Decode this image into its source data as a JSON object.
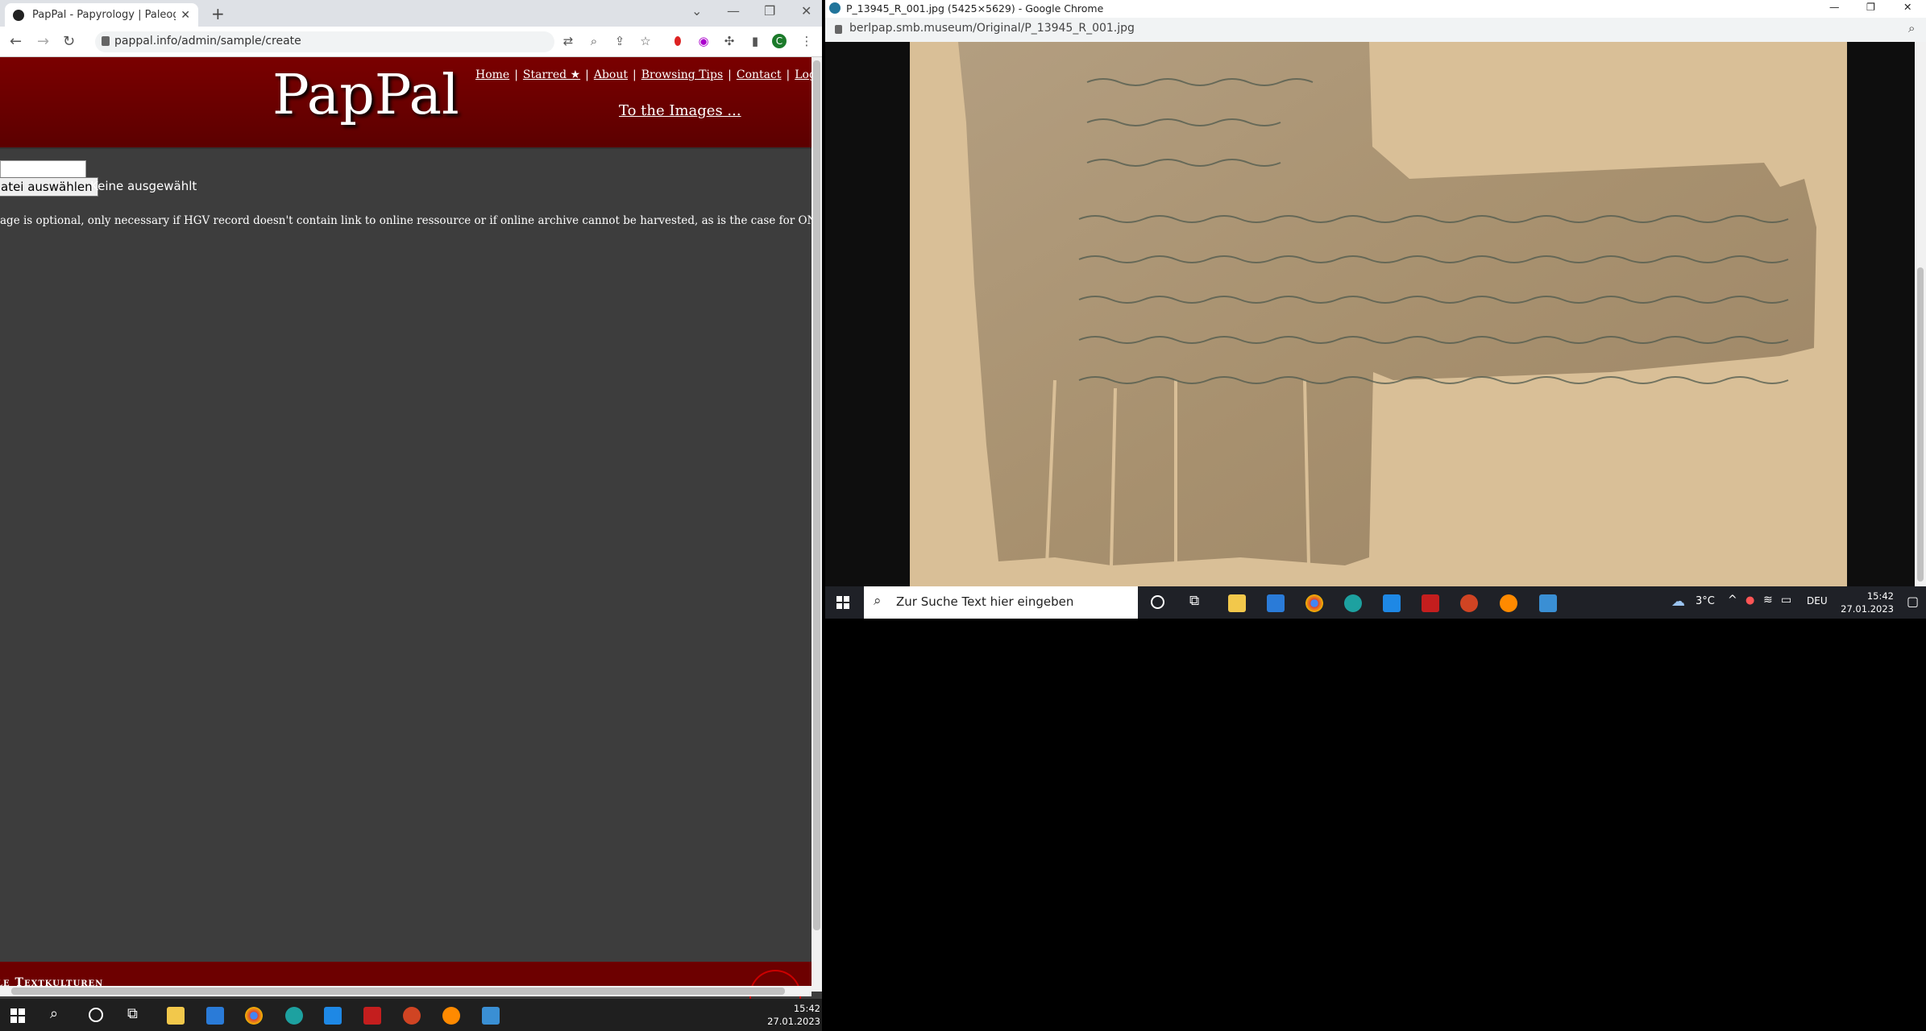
{
  "left_browser": {
    "tab_title": "PapPal - Papyrology | Paleograph",
    "url": "pappal.info/admin/sample/create",
    "profile_initial": "C"
  },
  "site": {
    "logo": "PapPal",
    "nav": [
      "Home",
      "Starred ★",
      "About",
      "Browsing Tips",
      "Contact",
      "Logout"
    ],
    "to_images": "To the Images ...",
    "file_button": "atei auswählen",
    "file_none": "Keine ausgewählt",
    "note": "age is optional, only necessary if HGV record doesn't contain link to online ressource or if online archive cannot be harvested, as is the case for ONB)",
    "footer_text": "le Textkulturen"
  },
  "left_taskbar": {
    "time": "15:42",
    "date": "27.01.2023"
  },
  "right_browser": {
    "title": "P_13945_R_001.jpg (5425×5629) - Google Chrome",
    "url": "berlpap.smb.museum/Original/P_13945_R_001.jpg"
  },
  "right_taskbar": {
    "search_placeholder": "Zur Suche Text hier eingeben",
    "weather": "3°C",
    "lang": "DEU",
    "time": "15:42",
    "date": "27.01.2023"
  },
  "colors": {
    "header_red": "#6d0000",
    "page_bg": "#3d3d3d",
    "papyrus": "#d9bf97"
  }
}
